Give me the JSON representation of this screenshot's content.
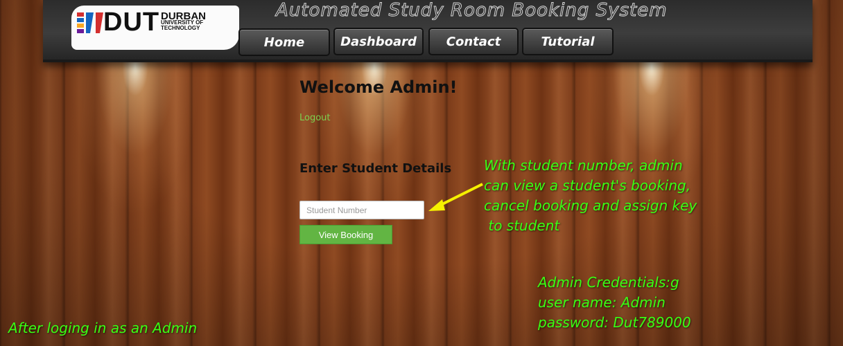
{
  "header": {
    "logo": {
      "brand": "DUT",
      "institution_line1": "DURBAN",
      "institution_line2": "UNIVERSITY OF",
      "institution_line3": "TECHNOLOGY"
    },
    "title": "Automated Study Room Booking System",
    "nav": [
      {
        "label": "Home"
      },
      {
        "label": "Dashboard"
      },
      {
        "label": "Contact"
      },
      {
        "label": "Tutorial"
      }
    ]
  },
  "main": {
    "welcome": "Welcome Admin!",
    "logout": "Logout",
    "section_title": "Enter Student Details",
    "student_number_placeholder": "Student Number",
    "view_booking_label": "View Booking"
  },
  "annotations": {
    "arrow_note": [
      "With student number, admin",
      "can view a student's booking,",
      "cancel booking and assign key",
      " to student"
    ],
    "credentials": [
      "Admin Credentials:g",
      "user name: Admin",
      "password: Dut789000"
    ],
    "caption": "After loging in as an Admin"
  },
  "colors": {
    "accent_green": "#62b543",
    "annotation_green": "#39ff14",
    "logout_green": "#7dd14f",
    "arrow_yellow": "#f5f000"
  }
}
